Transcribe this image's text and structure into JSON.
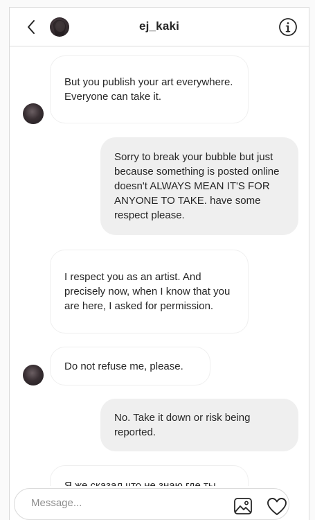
{
  "header": {
    "username": "ej_kaki",
    "back_icon": "chevron-left-icon",
    "info_icon": "info-icon"
  },
  "messages": [
    {
      "side": "in",
      "text": "But you publish your art everywhere. Everyone can take it."
    },
    {
      "side": "out",
      "text": "Sorry to break your bubble but just because something is posted online doesn't ALWAYS MEAN IT'S FOR ANYONE TO TAKE. have some respect please."
    },
    {
      "side": "in",
      "text": "I respect you as an artist. And precisely now, when I know that you are here, I asked for permission."
    },
    {
      "side": "in",
      "text": "Do not refuse me, please."
    },
    {
      "side": "out",
      "text": "No. Take it down or risk being reported."
    },
    {
      "side": "in",
      "text": "Я же сказал что не знаю где ты"
    }
  ],
  "composer": {
    "placeholder": "Message...",
    "image_icon": "image-icon",
    "like_icon": "heart-icon"
  },
  "colors": {
    "border": "#dbdbdb",
    "outgoing_bubble": "#efefef",
    "text": "#262626",
    "placeholder": "#8e8e8e"
  }
}
